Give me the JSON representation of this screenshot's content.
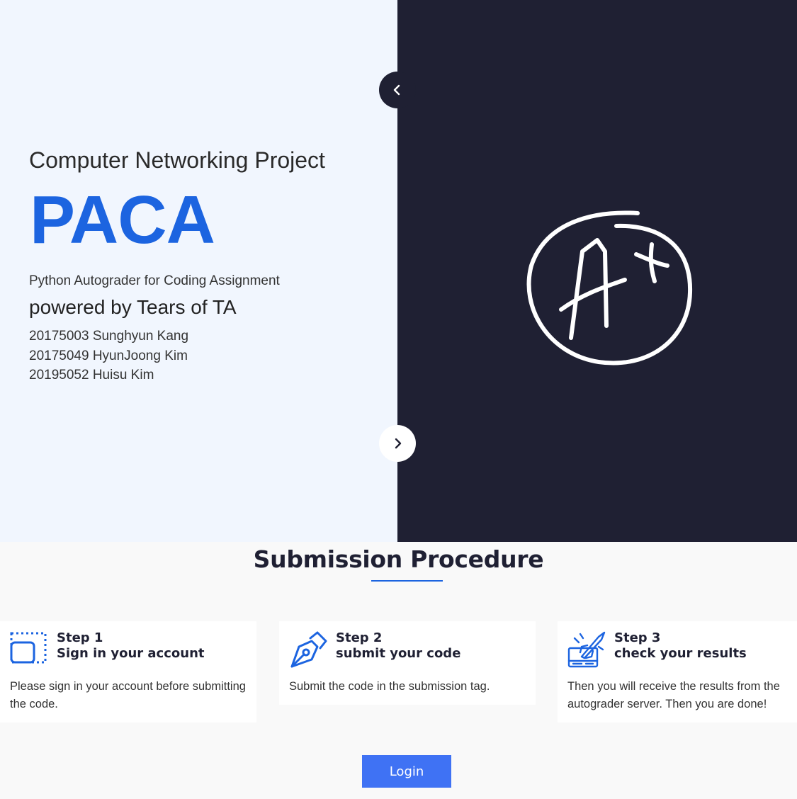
{
  "hero": {
    "subtitle": "Computer Networking Project",
    "brand": "PACA",
    "tagline": "Python Autograder for Coding Assignment",
    "powered_by": "powered by Tears of TA",
    "members": [
      "20175003 Sunghyun Kang",
      "20175049 HyunJoong Kim",
      "20195052 Huisu Kim"
    ],
    "colors": {
      "left_bg": "#f1f6fe",
      "right_bg": "#1f2033",
      "brand": "#1c64e0"
    },
    "icons": {
      "prev": "chevron-left-icon",
      "next": "chevron-right-icon",
      "art": "a-plus-grade-icon"
    }
  },
  "procedure": {
    "title": "Submission Procedure",
    "steps": [
      {
        "number": "Step 1",
        "heading": "Sign in your account",
        "description": "Please sign in your account before submitting the code.",
        "icon": "sign-in-frame-icon"
      },
      {
        "number": "Step 2",
        "heading": "submit your code",
        "description": "Submit the code in the submission tag.",
        "icon": "pen-nib-icon"
      },
      {
        "number": "Step 3",
        "heading": "check your results",
        "description": "Then you will receive the results from the autograder server. Then you are done!",
        "icon": "rocket-launch-icon"
      }
    ]
  },
  "login": {
    "label": "Login",
    "color": "#3f72f4"
  }
}
